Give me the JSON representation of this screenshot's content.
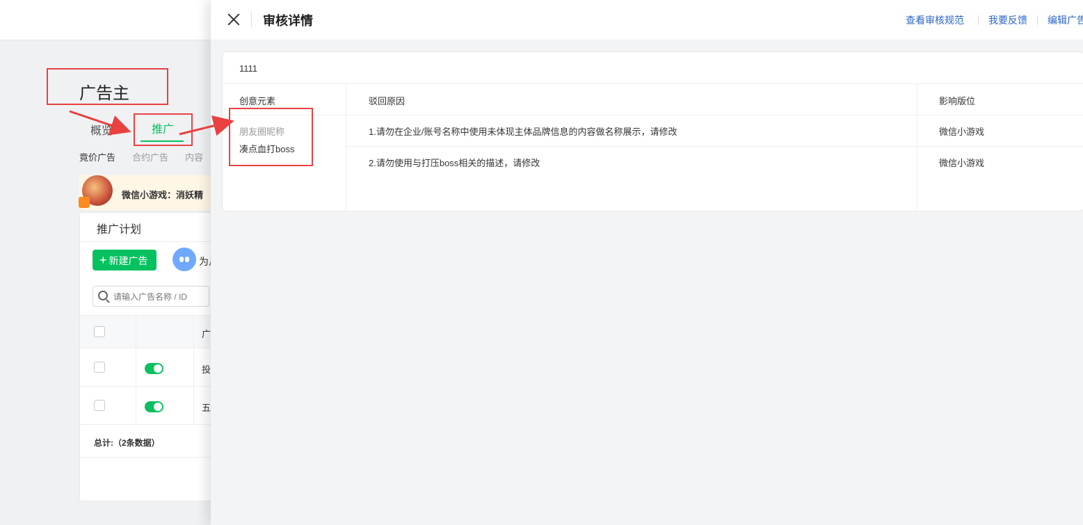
{
  "background": {
    "page_title": "广告主",
    "tabs": [
      {
        "label": "概览"
      },
      {
        "label": "推广"
      }
    ],
    "subtabs": [
      {
        "label": "竟价广告"
      },
      {
        "label": "合约广告"
      },
      {
        "label": "内容"
      }
    ],
    "banner": {
      "text": "微信小游戏：消妖精"
    },
    "plan": {
      "title": "推广计划",
      "new_button": "新建广告",
      "assistant_text": "为月",
      "search_placeholder": "请输入广告名称 / ID",
      "header_cell": "广",
      "rows": [
        {
          "text": "投",
          "enabled": true
        },
        {
          "text": "五",
          "enabled": true
        }
      ],
      "total": "总计:（2条数据）"
    }
  },
  "drawer": {
    "title": "审核详情",
    "links": [
      {
        "label": "查看审核规范"
      },
      {
        "label": "我要反馈"
      },
      {
        "label": "编辑广告"
      }
    ],
    "ad_name": "1111",
    "table": {
      "headers": [
        "创意元素",
        "驳回原因",
        "影响版位"
      ],
      "element": {
        "type": "朋友圈昵称",
        "value": "凑点血打boss"
      },
      "rows": [
        {
          "reason": "1.请勿在企业/账号名称中使用未体现主体品牌信息的内容做名称展示，请修改",
          "placement": "微信小游戏"
        },
        {
          "reason": "2.请勿使用与打压boss相关的描述，请修改",
          "placement": "微信小游戏"
        }
      ]
    }
  },
  "colors": {
    "accent": "#07c160",
    "link": "#2b67c6",
    "annotation": "#e94040"
  }
}
